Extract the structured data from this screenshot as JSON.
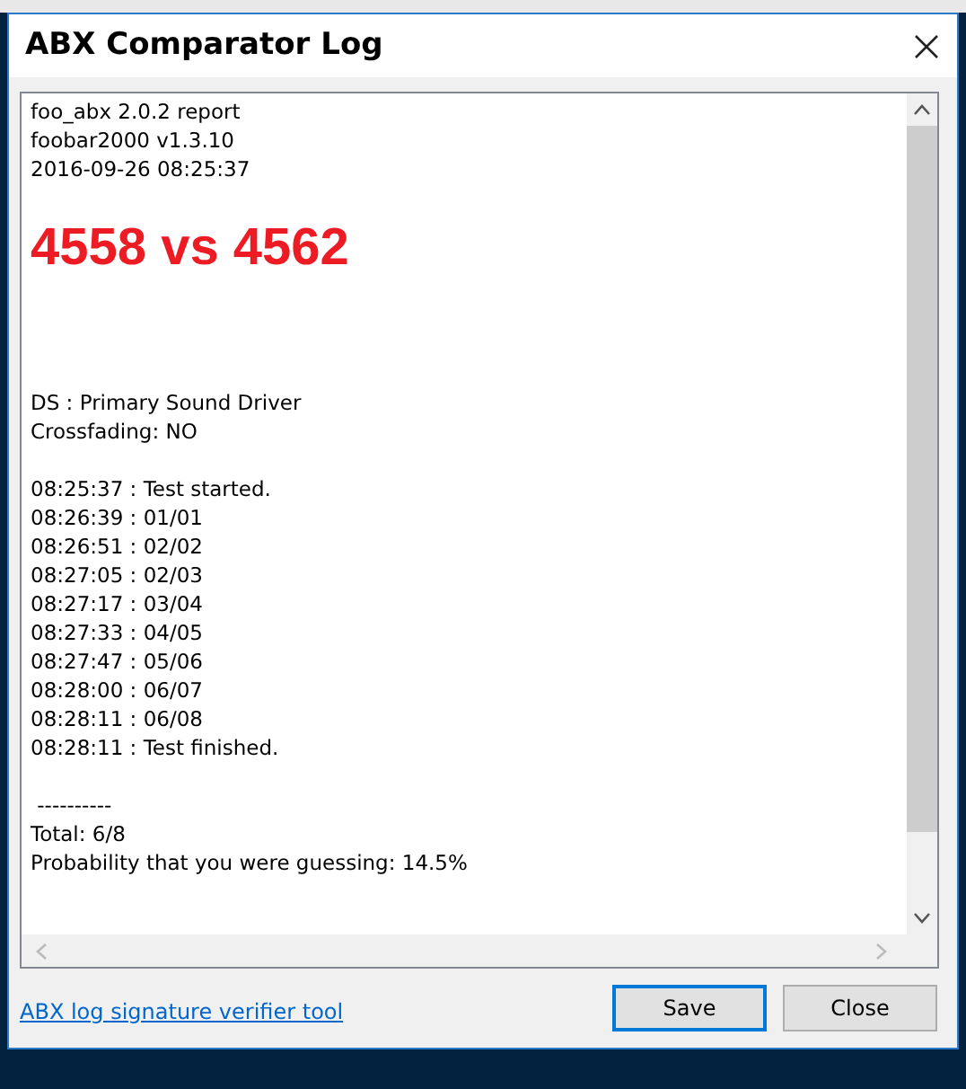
{
  "window": {
    "title": "ABX Comparator Log"
  },
  "log": [
    {
      "kind": "text",
      "text": "foo_abx 2.0.2 report"
    },
    {
      "kind": "text",
      "text": "foobar2000 v1.3.10"
    },
    {
      "kind": "text",
      "text": "2016-09-26 08:25:37"
    },
    {
      "kind": "headline",
      "text": "4558 vs 4562"
    },
    {
      "kind": "cut",
      "text": "DS : Primary Sound Driver"
    },
    {
      "kind": "text",
      "text": "Crossfading: NO"
    },
    {
      "kind": "blank"
    },
    {
      "kind": "text",
      "text": "08:25:37 : Test started."
    },
    {
      "kind": "text",
      "text": "08:26:39 : 01/01"
    },
    {
      "kind": "text",
      "text": "08:26:51 : 02/02"
    },
    {
      "kind": "text",
      "text": "08:27:05 : 02/03"
    },
    {
      "kind": "text",
      "text": "08:27:17 : 03/04"
    },
    {
      "kind": "text",
      "text": "08:27:33 : 04/05"
    },
    {
      "kind": "text",
      "text": "08:27:47 : 05/06"
    },
    {
      "kind": "text",
      "text": "08:28:00 : 06/07"
    },
    {
      "kind": "text",
      "text": "08:28:11 : 06/08"
    },
    {
      "kind": "text",
      "text": "08:28:11 : Test finished."
    },
    {
      "kind": "blank"
    },
    {
      "kind": "text",
      "text": " ----------"
    },
    {
      "kind": "text",
      "text": "Total: 6/8"
    },
    {
      "kind": "text",
      "text": "Probability that you were guessing: 14.5%"
    }
  ],
  "link": "ABX log signature verifier tool",
  "buttons": [
    {
      "label": "Save",
      "selected": true
    },
    {
      "label": "Close",
      "selected": false
    }
  ]
}
